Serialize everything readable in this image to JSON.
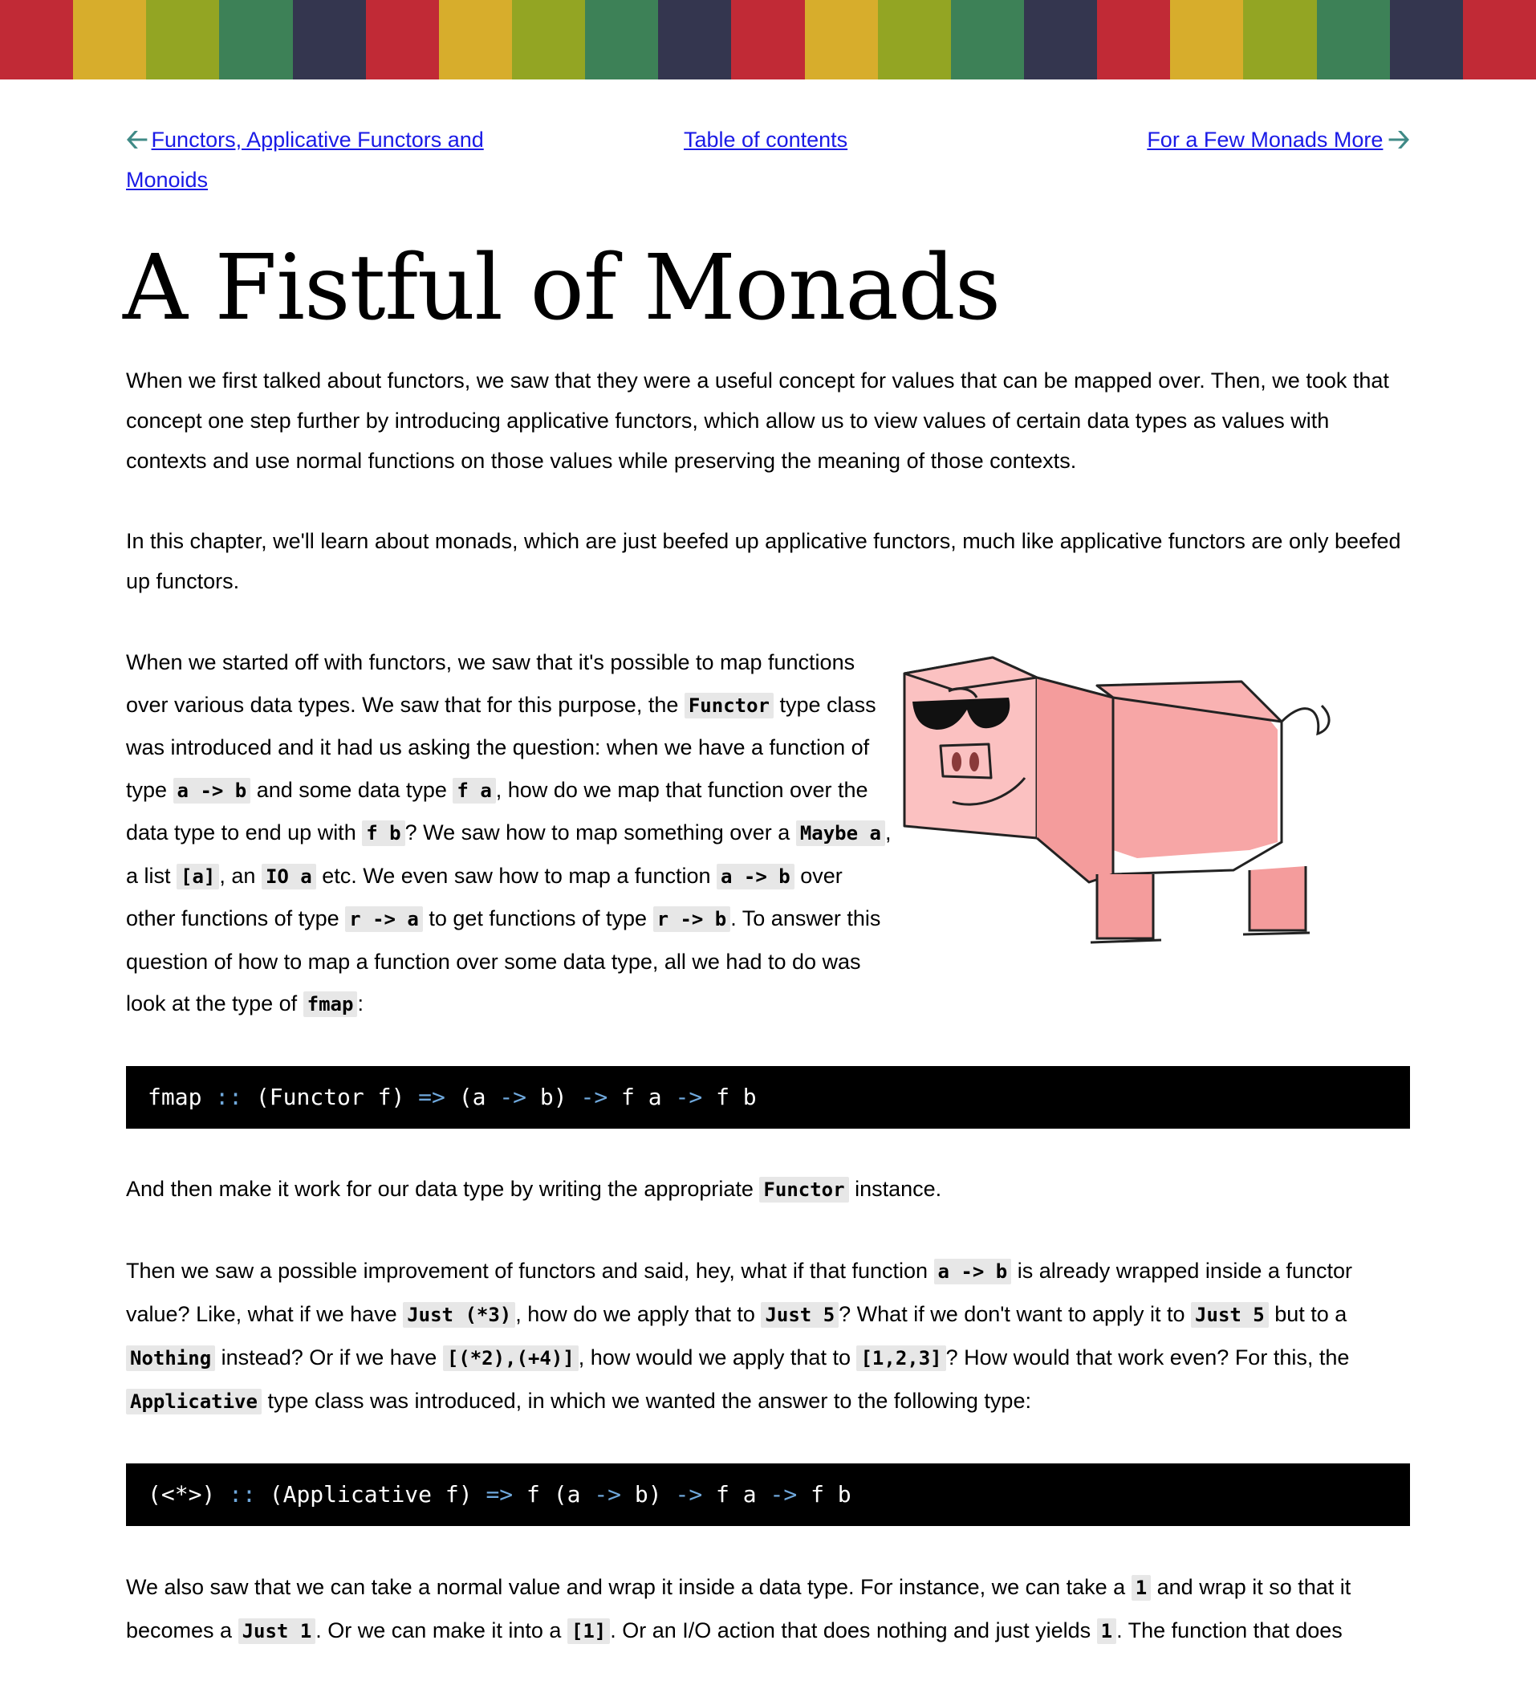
{
  "stripe_colors": [
    "#c12a36",
    "#d7ad2c",
    "#93a523",
    "#3d8157",
    "#34364f",
    "#c12a36",
    "#d7ad2c",
    "#93a523",
    "#3d8157",
    "#34364f",
    "#c12a36",
    "#d7ad2c",
    "#93a523",
    "#3d8157",
    "#34364f",
    "#c12a36",
    "#d7ad2c",
    "#93a523",
    "#3d8157",
    "#34364f",
    "#c12a36"
  ],
  "nav": {
    "prev_label": "Functors, Applicative Functors and Monoids",
    "toc_label": "Table of contents",
    "next_label": "For a Few Monads More"
  },
  "title": "A Fistful of Monads",
  "p1": "When we first talked about functors, we saw that they were a useful concept for values that can be mapped over. Then, we took that concept one step further by introducing applicative functors, which allow us to view values of certain data types as values with contexts and use normal functions on those values while preserving the meaning of those contexts.",
  "p2": "In this chapter, we'll learn about monads, which are just beefed up applicative functors, much like applicative functors are only beefed up functors.",
  "p3": {
    "t1": "When we started off with functors, we saw that it's possible to map functions over various data types. We saw that for this purpose, the ",
    "c1": "Functor",
    "t2": " type class was introduced and it had us asking the question: when we have a function of type ",
    "c2": "a -> b",
    "t3": " and some data type ",
    "c3": "f a",
    "t4": ", how do we map that function over the data type to end up with ",
    "c4": "f b",
    "t5": "? We saw how to map something over a ",
    "c5": "Maybe a",
    "t6": ", a list ",
    "c6": "[a]",
    "t7": ", an ",
    "c7": "IO a",
    "t8": " etc. We even saw how to map a function ",
    "c8": "a -> b",
    "t9": " over other functions of type ",
    "c9": "r -> a",
    "t10": " to get functions of type ",
    "c10": "r -> b",
    "t11": ". To answer this question of how to map a function over some data type, all we had to do was look at the type of ",
    "c11": "fmap",
    "t12": ":"
  },
  "code1": {
    "a": "fmap ",
    "b": "::",
    "c": " (Functor f) ",
    "d": "=>",
    "e": " (a ",
    "f": "->",
    "g": " b) ",
    "h": "->",
    "i": " f a ",
    "j": "->",
    "k": " f b"
  },
  "p4": {
    "t1": "And then make it work for our data type by writing the appropriate ",
    "c1": "Functor",
    "t2": " instance."
  },
  "p5": {
    "t1": "Then we saw a possible improvement of functors and said, hey, what if that function ",
    "c1": "a -> b",
    "t2": " is already wrapped inside a functor value? Like, what if we have ",
    "c2": "Just (*3)",
    "t3": ", how do we apply that to ",
    "c3": "Just 5",
    "t4": "? What if we don't want to apply it to ",
    "c4": "Just 5",
    "t5": " but to a ",
    "c5": "Nothing",
    "t6": " instead? Or if we have ",
    "c6": "[(*2),(+4)]",
    "t7": ", how would we apply that to ",
    "c7": "[1,2,3]",
    "t8": "? How would that work even? For this, the ",
    "c8": "Applicative",
    "t9": " type class was introduced, in which we wanted the answer to the following type:"
  },
  "code2": {
    "a": "(<*>) ",
    "b": "::",
    "c": " (Applicative f) ",
    "d": "=>",
    "e": " f (a ",
    "f": "->",
    "g": " b) ",
    "h": "->",
    "i": " f a ",
    "j": "->",
    "k": " f b"
  },
  "p6": {
    "t1": "We also saw that we can take a normal value and wrap it inside a data type. For instance, we can take a ",
    "c1": "1",
    "t2": " and wrap it so that it becomes a ",
    "c2": "Just 1",
    "t3": ". Or we can make it into a ",
    "c3": "[1]",
    "t4": ". Or an I/O action that does nothing and just yields ",
    "c4": "1",
    "t5": ". The function that does"
  }
}
